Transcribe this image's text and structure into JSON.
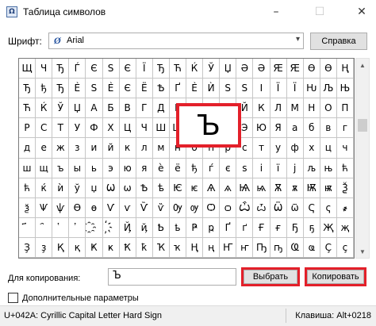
{
  "window": {
    "title": "Таблица символов",
    "app_icon": "charmap-icon",
    "controls": {
      "minimize": "–",
      "maximize": "☐",
      "close": "✕"
    }
  },
  "font_row": {
    "label": "Шрифт:",
    "font_icon": "Ø",
    "value": "Arial",
    "dropdown_glyph": "▾",
    "help_label": "Справка"
  },
  "grid": {
    "rows": [
      [
        "Щ",
        "Ч",
        "Ђ",
        "Ѓ",
        "Є",
        "Ѕ",
        "Є",
        "Ї",
        "Ђ",
        "Ћ",
        "Ќ",
        "Ў",
        "Џ",
        "Ә",
        "Ә",
        "Ԙ",
        "Ԙ",
        "Ө",
        "Ө",
        "Ң"
      ],
      [
        "Ђ",
        "ђ",
        "Ђ",
        "Ѐ",
        "Ѕ",
        "Ѐ",
        "Є",
        "Ё",
        "Ѣ",
        "Ґ",
        "Ѐ",
        "Ѝ",
        "Ѕ",
        "Ѕ",
        "І",
        "Ї",
        "Ї",
        "Ԋ",
        "Љ",
        "Њ"
      ],
      [
        "Ћ",
        "Ќ",
        "Ў",
        "Џ",
        "А",
        "Б",
        "В",
        "Г",
        "Д",
        "Е",
        "Ж",
        "З",
        "И",
        "Й",
        "К",
        "Л",
        "М",
        "Н",
        "О",
        "П"
      ],
      [
        "Р",
        "С",
        "Т",
        "У",
        "Ф",
        "Х",
        "Ц",
        "Ч",
        "Ш",
        "Щ",
        "Ъ",
        "Ы",
        "Ь",
        "Э",
        "Ю",
        "Я",
        "а",
        "б",
        "в",
        "г"
      ],
      [
        "д",
        "е",
        "ж",
        "з",
        "и",
        "й",
        "к",
        "л",
        "м",
        "н",
        "о",
        "п",
        "р",
        "с",
        "т",
        "у",
        "ф",
        "х",
        "ц",
        "ч"
      ],
      [
        "ш",
        "щ",
        "ъ",
        "ы",
        "ь",
        "э",
        "ю",
        "я",
        "ѐ",
        "ё",
        "ђ",
        "ѓ",
        "є",
        "ѕ",
        "і",
        "ї",
        "ј",
        "љ",
        "њ",
        "ћ"
      ],
      [
        "ћ",
        "ќ",
        "ѝ",
        "ў",
        "џ",
        "Ѡ",
        "ѡ",
        "Ѣ",
        "ѣ",
        "Ѥ",
        "ѥ",
        "Ѧ",
        "ѧ",
        "Ѩ",
        "ѩ",
        "Ѫ",
        "ѫ",
        "Ѭ",
        "ѭ",
        "Ѯ"
      ],
      [
        "ѯ",
        "Ѱ",
        "ѱ",
        "Ѳ",
        "ѳ",
        "Ѵ",
        "ѵ",
        "Ѷ",
        "ѷ",
        "Ѹ",
        "ѹ",
        "Ѻ",
        "ѻ",
        "Ѽ",
        "ѽ",
        "Ѿ",
        "ѿ",
        "Ҁ",
        "ҁ",
        "҂"
      ],
      [
        "҃",
        "҄",
        "҅",
        "҆",
        "҈",
        "҉",
        "Ҋ",
        "ҋ",
        "Ҍ",
        "ҍ",
        "Ҏ",
        "ҏ",
        "Ґ",
        "ґ",
        "Ғ",
        "ғ",
        "Ҕ",
        "ҕ",
        "Җ",
        "җ"
      ],
      [
        "Ҙ",
        "ҙ",
        "Қ",
        "қ",
        "Ҝ",
        "ҝ",
        "Ҟ",
        "ҟ",
        "Ҡ",
        "ҡ",
        "Ң",
        "ң",
        "Ҥ",
        "ҥ",
        "Ҧ",
        "ҧ",
        "Ҩ",
        "ҩ",
        "Ҫ",
        "ҫ"
      ]
    ],
    "selected_char": "Ъ",
    "highlight_color": "#e3202a"
  },
  "copy_row": {
    "label": "Для копирования:",
    "value": "Ъ",
    "select_label": "Выбрать",
    "copy_label": "Копировать"
  },
  "advanced": {
    "label": "Дополнительные параметры",
    "checked": false
  },
  "status": {
    "left": "U+042A: Cyrillic Capital Letter Hard Sign",
    "right": "Клавиша: Alt+0218"
  },
  "scrollbar": {
    "up": "▲",
    "down": "▼"
  }
}
